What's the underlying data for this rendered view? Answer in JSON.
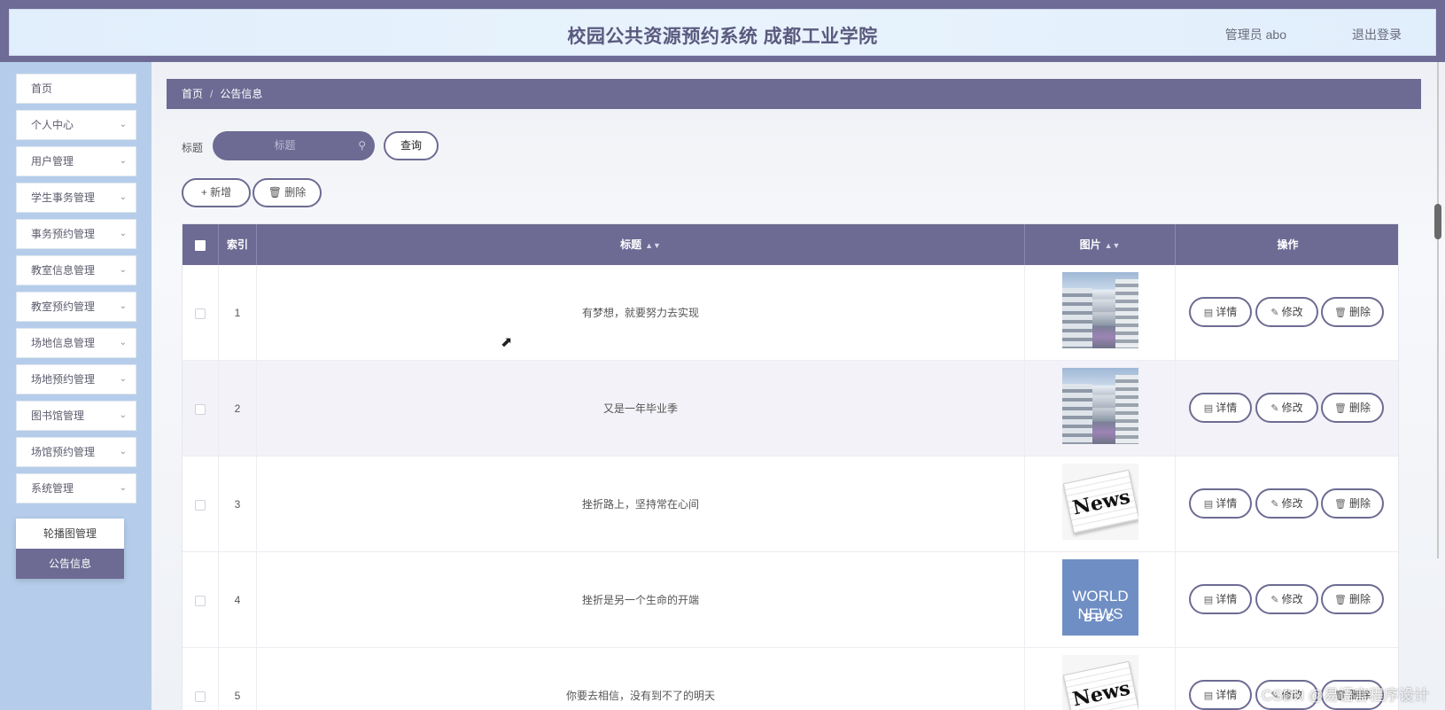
{
  "header": {
    "title": "校园公共资源预约系统 成都工业学院",
    "admin": "管理员 abo",
    "logout": "退出登录"
  },
  "sidebar": {
    "items": [
      {
        "label": "首页",
        "has_chevron": false
      },
      {
        "label": "个人中心",
        "has_chevron": true
      },
      {
        "label": "用户管理",
        "has_chevron": true
      },
      {
        "label": "学生事务管理",
        "has_chevron": true
      },
      {
        "label": "事务预约管理",
        "has_chevron": true
      },
      {
        "label": "教室信息管理",
        "has_chevron": true
      },
      {
        "label": "教室预约管理",
        "has_chevron": true
      },
      {
        "label": "场地信息管理",
        "has_chevron": true
      },
      {
        "label": "场地预约管理",
        "has_chevron": true
      },
      {
        "label": "图书馆管理",
        "has_chevron": true
      },
      {
        "label": "场馆预约管理",
        "has_chevron": true
      },
      {
        "label": "系统管理",
        "has_chevron": true
      }
    ],
    "submenu": [
      {
        "label": "轮播图管理",
        "active": false
      },
      {
        "label": "公告信息",
        "active": true
      }
    ]
  },
  "breadcrumb": {
    "home": "首页",
    "separator": "/",
    "current": "公告信息"
  },
  "search": {
    "label": "标题",
    "placeholder": "标题",
    "query_button": "查询"
  },
  "actions": {
    "add": "新增",
    "delete": "删除"
  },
  "table": {
    "columns": {
      "index": "索引",
      "title": "标题",
      "image": "图片",
      "operations": "操作"
    },
    "rows": [
      {
        "index": "1",
        "title": "有梦想，就要努力去实现",
        "image": "building"
      },
      {
        "index": "2",
        "title": "又是一年毕业季",
        "image": "building"
      },
      {
        "index": "3",
        "title": "挫折路上，坚持常在心间",
        "image": "news"
      },
      {
        "index": "4",
        "title": "挫折是另一个生命的开端",
        "image": "bbc"
      },
      {
        "index": "5",
        "title": "你要去相信，没有到不了的明天",
        "image": "news"
      }
    ],
    "row_buttons": {
      "detail": "详情",
      "edit": "修改",
      "delete": "删除"
    },
    "news_text": "News",
    "bbc_text": "BBC",
    "world_news_line1": "WORLD",
    "world_news_line2": "NEWS"
  },
  "watermark": "CSDN @易语言程序设计",
  "colors": {
    "primary": "#6d6b93",
    "sidebar_bg": "#b5cdea",
    "header_bg": "#e5f1fc"
  }
}
